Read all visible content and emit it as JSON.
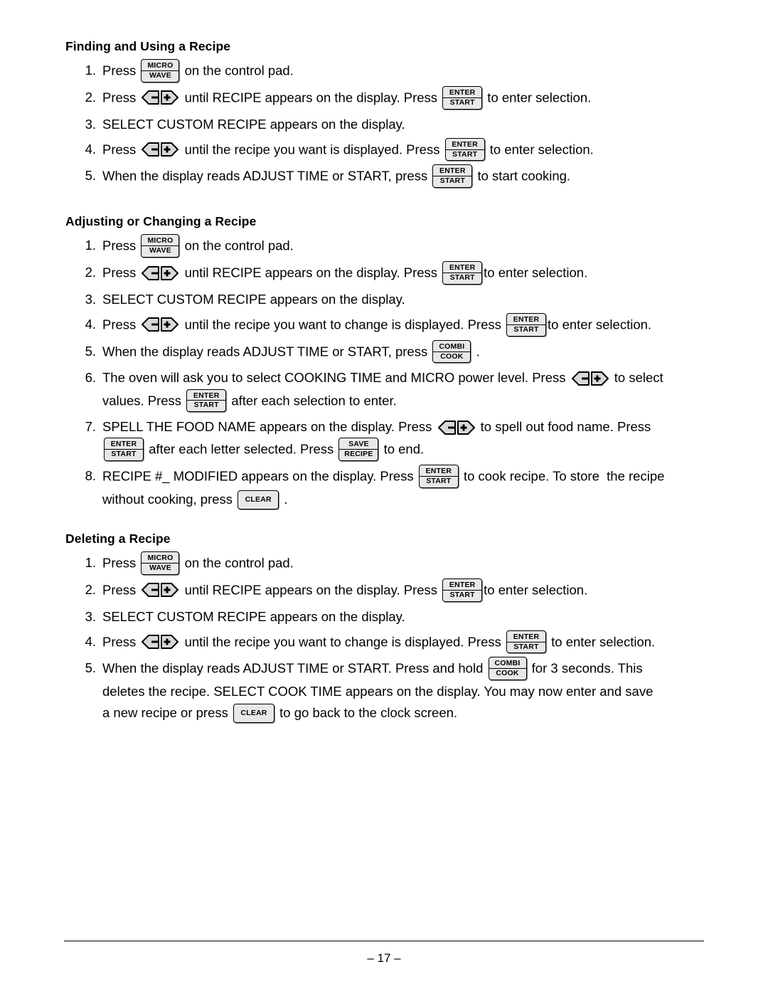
{
  "page": {
    "number": "– 17 –"
  },
  "keys": {
    "micro_wave": {
      "line1": "MICRO",
      "line2": "WAVE"
    },
    "enter_start": {
      "line1": "ENTER",
      "line2": "START"
    },
    "combi_cook": {
      "line1": "COMBI",
      "line2": "COOK"
    },
    "save_recipe": {
      "line1": "SAVE",
      "line2": "RECIPE"
    },
    "clear": {
      "line1": "CLEAR"
    },
    "arrows": {
      "left": "left-arrow-key",
      "right": "right-arrow-key"
    }
  },
  "sections": [
    {
      "title": "Finding and Using a Recipe",
      "steps": [
        {
          "num": "1.",
          "parts": [
            {
              "t": "text",
              "v": "Press "
            },
            {
              "t": "key",
              "k": "micro_wave"
            },
            {
              "t": "text",
              "v": " on the control pad."
            }
          ]
        },
        {
          "num": "2.",
          "parts": [
            {
              "t": "text",
              "v": "Press "
            },
            {
              "t": "arrows"
            },
            {
              "t": "text",
              "v": " until RECIPE appears on the display. Press "
            },
            {
              "t": "key",
              "k": "enter_start"
            },
            {
              "t": "text",
              "v": " to enter selection."
            }
          ]
        },
        {
          "num": "3.",
          "parts": [
            {
              "t": "text",
              "v": "SELECT CUSTOM RECIPE appears on the display."
            }
          ]
        },
        {
          "num": "4.",
          "parts": [
            {
              "t": "text",
              "v": "Press "
            },
            {
              "t": "arrows"
            },
            {
              "t": "text",
              "v": " until the recipe you want is displayed. Press "
            },
            {
              "t": "key",
              "k": "enter_start"
            },
            {
              "t": "text",
              "v": " to enter selection."
            }
          ]
        },
        {
          "num": "5.",
          "parts": [
            {
              "t": "text",
              "v": "When the display reads ADJUST TIME or START, press "
            },
            {
              "t": "key",
              "k": "enter_start"
            },
            {
              "t": "text",
              "v": " to start cooking."
            }
          ]
        }
      ]
    },
    {
      "title": "Adjusting or Changing a Recipe",
      "steps": [
        {
          "num": "1.",
          "parts": [
            {
              "t": "text",
              "v": "Press "
            },
            {
              "t": "key",
              "k": "micro_wave"
            },
            {
              "t": "text",
              "v": " on the control pad."
            }
          ]
        },
        {
          "num": "2.",
          "parts": [
            {
              "t": "text",
              "v": "Press "
            },
            {
              "t": "arrows"
            },
            {
              "t": "text",
              "v": " until RECIPE appears on the display. Press "
            },
            {
              "t": "key",
              "k": "enter_start"
            },
            {
              "t": "text",
              "v": "to enter selection."
            }
          ]
        },
        {
          "num": "3.",
          "parts": [
            {
              "t": "text",
              "v": "SELECT CUSTOM RECIPE appears on the display."
            }
          ]
        },
        {
          "num": "4.",
          "parts": [
            {
              "t": "text",
              "v": "Press "
            },
            {
              "t": "arrows"
            },
            {
              "t": "text",
              "v": " until the recipe you want to change is displayed. Press "
            },
            {
              "t": "key",
              "k": "enter_start"
            },
            {
              "t": "text",
              "v": "to enter selection."
            }
          ]
        },
        {
          "num": "5.",
          "parts": [
            {
              "t": "text",
              "v": "When the display reads ADJUST TIME or START, press "
            },
            {
              "t": "key",
              "k": "combi_cook"
            },
            {
              "t": "text",
              "v": " ."
            }
          ]
        },
        {
          "num": "6.",
          "parts": [
            {
              "t": "text",
              "v": "The oven will ask you to select COOKING TIME and MICRO power level. Press "
            },
            {
              "t": "arrows"
            },
            {
              "t": "text",
              "v": " to select\nvalues. Press "
            },
            {
              "t": "key",
              "k": "enter_start"
            },
            {
              "t": "text",
              "v": " after each selection to enter."
            }
          ]
        },
        {
          "num": "7.",
          "parts": [
            {
              "t": "text",
              "v": "SPELL THE FOOD NAME appears on the display. Press "
            },
            {
              "t": "arrows"
            },
            {
              "t": "text",
              "v": " to spell out food name. Press\n"
            },
            {
              "t": "key",
              "k": "enter_start"
            },
            {
              "t": "text",
              "v": " after each letter selected. Press "
            },
            {
              "t": "key",
              "k": "save_recipe"
            },
            {
              "t": "text",
              "v": " to end."
            }
          ]
        },
        {
          "num": "8.",
          "parts": [
            {
              "t": "text",
              "v": "RECIPE #_ MODIFIED appears on the display. Press "
            },
            {
              "t": "key",
              "k": "enter_start"
            },
            {
              "t": "text",
              "v": " to cook recipe. To store  the recipe\nwithout cooking, press "
            },
            {
              "t": "key",
              "k": "clear"
            },
            {
              "t": "text",
              "v": " ."
            }
          ]
        }
      ]
    },
    {
      "title": "Deleting a Recipe",
      "steps": [
        {
          "num": "1.",
          "parts": [
            {
              "t": "text",
              "v": "Press "
            },
            {
              "t": "key",
              "k": "micro_wave"
            },
            {
              "t": "text",
              "v": " on the control pad."
            }
          ]
        },
        {
          "num": "2.",
          "parts": [
            {
              "t": "text",
              "v": "Press "
            },
            {
              "t": "arrows"
            },
            {
              "t": "text",
              "v": " until RECIPE appears on the display. Press "
            },
            {
              "t": "key",
              "k": "enter_start"
            },
            {
              "t": "text",
              "v": "to enter selection."
            }
          ]
        },
        {
          "num": "3.",
          "parts": [
            {
              "t": "text",
              "v": "SELECT CUSTOM RECIPE appears on the display."
            }
          ]
        },
        {
          "num": "4.",
          "parts": [
            {
              "t": "text",
              "v": "Press "
            },
            {
              "t": "arrows"
            },
            {
              "t": "text",
              "v": " until the recipe you want to change is displayed. Press "
            },
            {
              "t": "key",
              "k": "enter_start"
            },
            {
              "t": "text",
              "v": " to enter selection."
            }
          ]
        },
        {
          "num": "5.",
          "parts": [
            {
              "t": "text",
              "v": "When the display reads ADJUST TIME or START. Press and hold "
            },
            {
              "t": "key",
              "k": "combi_cook"
            },
            {
              "t": "text",
              "v": " for 3 seconds. This\ndeletes the recipe. SELECT COOK TIME appears on the display. You may now enter and save\na new recipe or press "
            },
            {
              "t": "key",
              "k": "clear"
            },
            {
              "t": "text",
              "v": " to go back to the clock screen."
            }
          ]
        }
      ]
    }
  ]
}
